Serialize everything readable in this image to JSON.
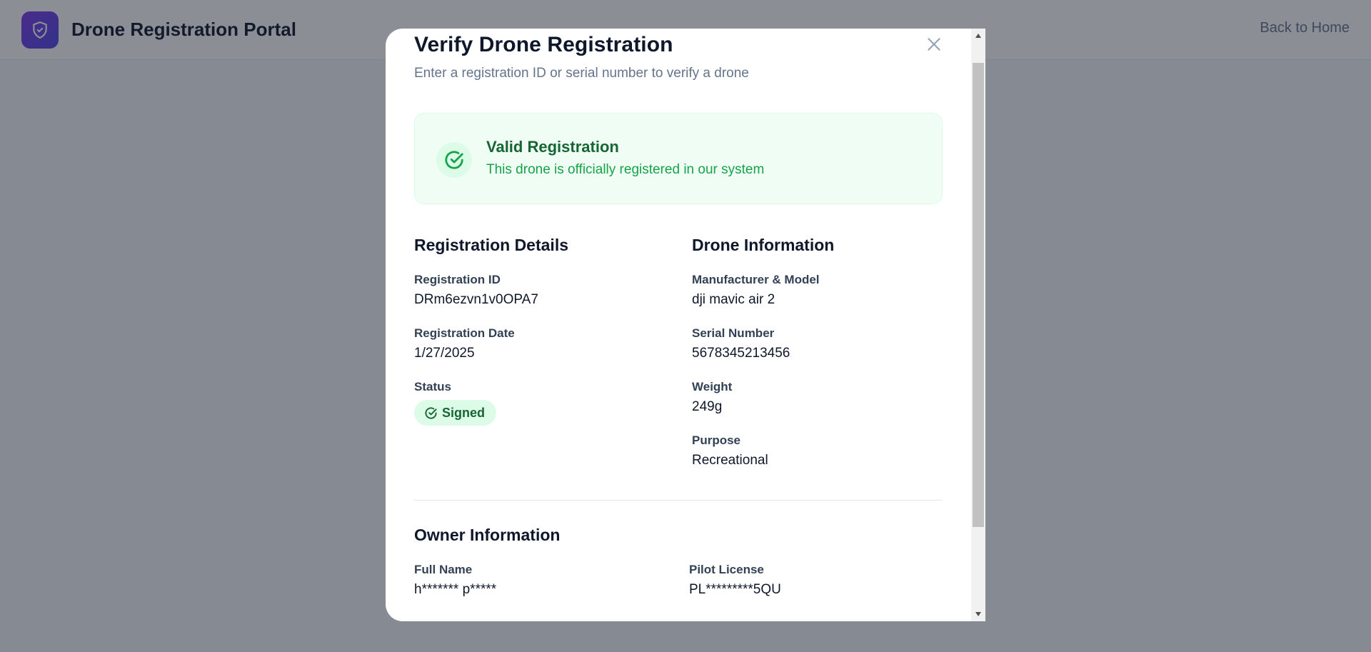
{
  "app": {
    "title": "Drone Registration Portal",
    "back_link": "Back to Home",
    "logo_icon": "shield-check-icon"
  },
  "modal": {
    "title": "Verify Drone Registration",
    "subtitle": "Enter a registration ID or serial number to verify a drone",
    "close_icon": "close-icon"
  },
  "result": {
    "title": "Valid Registration",
    "description": "This drone is officially registered in our system",
    "icon": "check-circle-icon",
    "color": "#16a34a"
  },
  "registration_details": {
    "title": "Registration Details",
    "id_label": "Registration ID",
    "id_value": "DRm6ezvn1v0OPA7",
    "date_label": "Registration Date",
    "date_value": "1/27/2025",
    "status_label": "Status",
    "status_value": "Signed"
  },
  "drone_information": {
    "title": "Drone Information",
    "model_label": "Manufacturer & Model",
    "model_value": "dji mavic air 2",
    "serial_label": "Serial Number",
    "serial_value": "5678345213456",
    "weight_label": "Weight",
    "weight_value": "249g",
    "purpose_label": "Purpose",
    "purpose_value": "Recreational"
  },
  "owner_information": {
    "title": "Owner Information",
    "name_label": "Full Name",
    "name_value": "h******* p*****",
    "license_label": "Pilot License",
    "license_value": "PL*********5QU"
  }
}
